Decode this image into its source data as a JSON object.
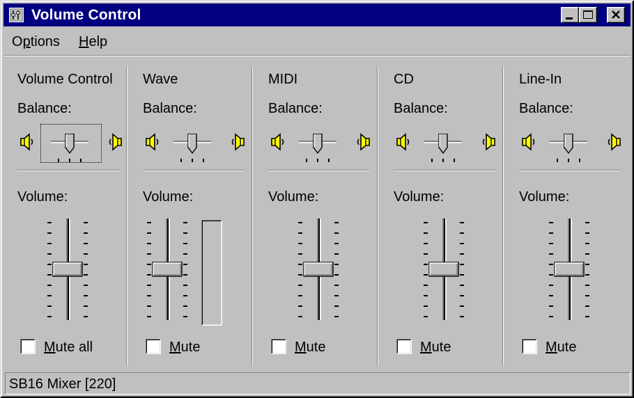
{
  "window": {
    "title": "Volume Control"
  },
  "menu": [
    {
      "label": "Options",
      "mnemonic": "p"
    },
    {
      "label": "Help",
      "mnemonic": "H"
    }
  ],
  "balance_label": "Balance:",
  "volume_label": "Volume:",
  "channels": [
    {
      "title": "Volume Control",
      "mute_label": "Mute all",
      "muted": false,
      "balance": 0.5,
      "volume": 0.5,
      "has_meter": false,
      "focused": true
    },
    {
      "title": "Wave",
      "mute_label": "Mute",
      "muted": false,
      "balance": 0.5,
      "volume": 0.5,
      "has_meter": true,
      "focused": false
    },
    {
      "title": "MIDI",
      "mute_label": "Mute",
      "muted": false,
      "balance": 0.5,
      "volume": 0.5,
      "has_meter": false,
      "focused": false
    },
    {
      "title": "CD",
      "mute_label": "Mute",
      "muted": false,
      "balance": 0.5,
      "volume": 0.5,
      "has_meter": false,
      "focused": false
    },
    {
      "title": "Line-In",
      "mute_label": "Mute",
      "muted": false,
      "balance": 0.5,
      "volume": 0.5,
      "has_meter": false,
      "focused": false
    }
  ],
  "status": {
    "text": "SB16 Mixer [220]"
  },
  "icons": {
    "app": "volume-control-app-icon",
    "minimize": "minimize-icon",
    "maximize": "maximize-icon",
    "close": "close-icon",
    "speaker_left": "speaker-left-icon",
    "speaker_right": "speaker-right-icon"
  },
  "colors": {
    "titlebar": "#000080",
    "face": "#c0c0c0",
    "speaker": "#ffff00"
  }
}
